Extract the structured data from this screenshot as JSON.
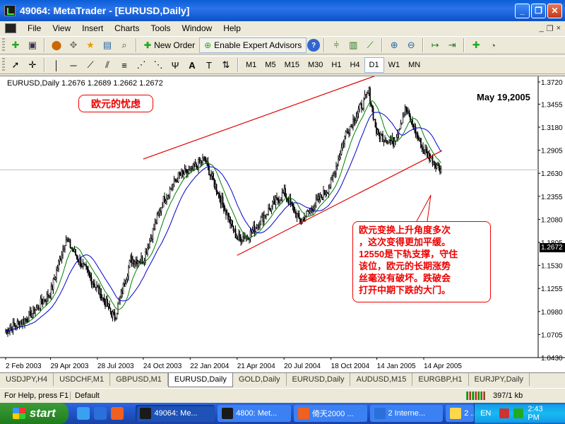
{
  "window": {
    "title": "49064: MetaTrader - [EURUSD,Daily]",
    "controls": [
      "_",
      "❐",
      "✕"
    ]
  },
  "menu": {
    "items": [
      "File",
      "View",
      "Insert",
      "Charts",
      "Tools",
      "Window",
      "Help"
    ],
    "mdi_controls": [
      "_",
      "❐",
      "×"
    ]
  },
  "toolbar": {
    "new_order": "New Order",
    "expert_advisors": "Enable Expert Advisors"
  },
  "timeframes": [
    "M1",
    "M5",
    "M15",
    "M30",
    "H1",
    "H4",
    "D1",
    "W1",
    "MN"
  ],
  "active_timeframe": "D1",
  "chart": {
    "header": "EURUSD,Daily  1.2676 1.2689 1.2662 1.2672",
    "date_note": "May 19,2005",
    "title_note": "欧元的忧虑",
    "annotation_lines": [
      "欧元变换上升角度多次",
      "，这次变得更加平缓。",
      "12550是下轨支撑，守住",
      "该位，欧元的长期涨势",
      "丝毫没有破坏。跌破会",
      "打开中期下跌的大门。"
    ],
    "current_price": "1.2672",
    "colors": {
      "channel": "#E00000",
      "ma_fast": "#008000",
      "ma_slow": "#0000CC",
      "candles": "#000000"
    }
  },
  "chart_data": {
    "type": "candlestick",
    "title": "EURUSD,Daily",
    "ohlc_last": {
      "open": 1.2676,
      "high": 1.2689,
      "low": 1.2662,
      "close": 1.2672
    },
    "y_ticks": [
      "1.3720",
      "1.3455",
      "1.3180",
      "1.2905",
      "1.2630",
      "1.2355",
      "1.2080",
      "1.1805",
      "1.1530",
      "1.1255",
      "1.0980",
      "1.0705",
      "1.0430"
    ],
    "x_ticks": [
      "2 Feb 2003",
      "29 Apr 2003",
      "28 Jul 2003",
      "24 Oct 2003",
      "22 Jan 2004",
      "21 Apr 2004",
      "20 Jul 2004",
      "18 Oct 2004",
      "14 Jan 2005",
      "14 Apr 2005"
    ],
    "ylim": [
      1.043,
      1.372
    ],
    "close_path": [
      [
        "2 Feb 2003",
        1.075
      ],
      [
        "15 Mar 2003",
        1.09
      ],
      [
        "29 Apr 2003",
        1.12
      ],
      [
        "28 May 2003",
        1.185
      ],
      [
        "28 Jul 2003",
        1.125
      ],
      [
        "30 Aug 2003",
        1.09
      ],
      [
        "30 Sep 2003",
        1.16
      ],
      [
        "24 Oct 2003",
        1.16
      ],
      [
        "1 Dec 2003",
        1.23
      ],
      [
        "31 Dec 2003",
        1.26
      ],
      [
        "22 Jan 2004",
        1.265
      ],
      [
        "18 Feb 2004",
        1.28
      ],
      [
        "21 Apr 2004",
        1.185
      ],
      [
        "15 May 2004",
        1.19
      ],
      [
        "15 Jun 2004",
        1.215
      ],
      [
        "20 Jul 2004",
        1.24
      ],
      [
        "20 Aug 2004",
        1.205
      ],
      [
        "30 Sep 2004",
        1.235
      ],
      [
        "18 Oct 2004",
        1.25
      ],
      [
        "15 Nov 2004",
        1.31
      ],
      [
        "30 Dec 2004",
        1.36
      ],
      [
        "14 Jan 2005",
        1.31
      ],
      [
        "15 Feb 2005",
        1.3
      ],
      [
        "10 Mar 2005",
        1.34
      ],
      [
        "14 Apr 2005",
        1.29
      ],
      [
        "19 May 2005",
        1.2672
      ]
    ],
    "series": [
      {
        "name": "EURUSD,Daily",
        "type": "candles"
      },
      {
        "type": "moving-average",
        "color": "#008000"
      },
      {
        "type": "moving-average",
        "color": "#0000CC"
      }
    ],
    "trend_lines": [
      {
        "type": "channel-upper",
        "from": [
          "24 Oct 2003",
          1.28
        ],
        "to": [
          "14 Jan 2005",
          1.38
        ]
      },
      {
        "type": "channel-lower",
        "from": [
          "21 Apr 2004",
          1.165
        ],
        "to": [
          "19 May 2005",
          1.29
        ]
      }
    ]
  },
  "tabs": [
    "USDJPY,H4",
    "USDCHF,M1",
    "GBPUSD,M1",
    "EURUSD,Daily",
    "GOLD,Daily",
    "EURUSD,Daily",
    "AUDUSD,M15",
    "EURGBP,H1",
    "EURJPY,Daily"
  ],
  "active_tab": 3,
  "status": {
    "help": "For Help, press F1",
    "profile": "Default",
    "traffic": "397/1 kb"
  },
  "taskbar": {
    "start": "start",
    "tasks": [
      {
        "label": "49064: Me...",
        "color": "#1a1a1a",
        "active": true
      },
      {
        "label": "4800: Met...",
        "color": "#1a1a1a",
        "active": false
      },
      {
        "label": "倚天2000 ...",
        "color": "#F06020",
        "active": false
      },
      {
        "label": "2 Interne...",
        "color": "#2B6FD9",
        "active": false
      },
      {
        "label": "2 ...",
        "color": "#FFD74A",
        "active": false
      }
    ],
    "lang": "EN",
    "clock": "2:43 PM"
  }
}
